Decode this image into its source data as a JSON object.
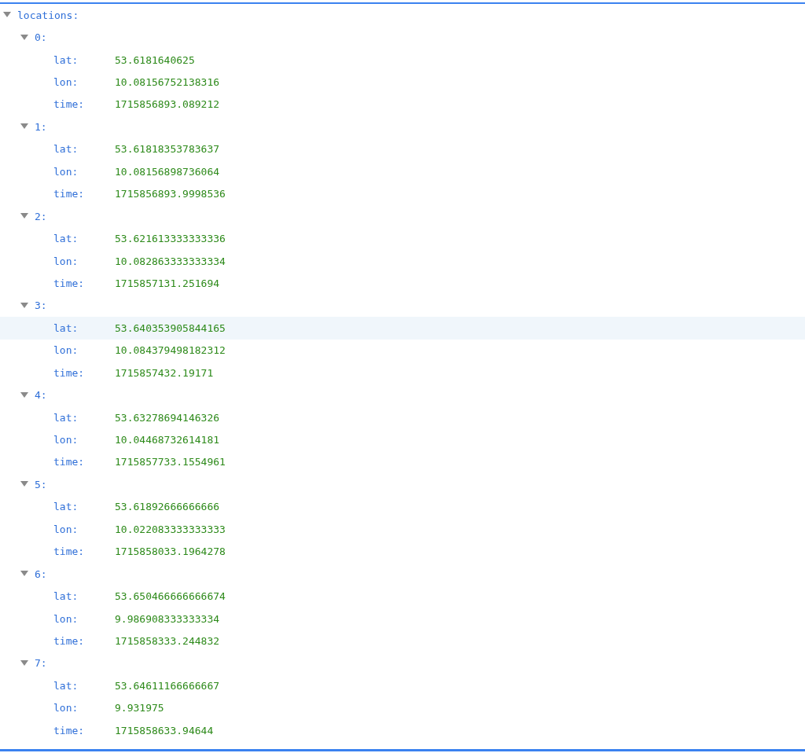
{
  "root": {
    "key": "locations:",
    "expanded": true
  },
  "locations": [
    {
      "key": "0:",
      "expanded": true,
      "fields": [
        {
          "key": "lat:",
          "value": "53.6181640625",
          "highlighted": false
        },
        {
          "key": "lon:",
          "value": "10.08156752138316",
          "highlighted": false
        },
        {
          "key": "time:",
          "value": "1715856893.089212",
          "highlighted": false
        }
      ]
    },
    {
      "key": "1:",
      "expanded": true,
      "fields": [
        {
          "key": "lat:",
          "value": "53.61818353783637",
          "highlighted": false
        },
        {
          "key": "lon:",
          "value": "10.08156898736064",
          "highlighted": false
        },
        {
          "key": "time:",
          "value": "1715856893.9998536",
          "highlighted": false
        }
      ]
    },
    {
      "key": "2:",
      "expanded": true,
      "fields": [
        {
          "key": "lat:",
          "value": "53.621613333333336",
          "highlighted": false
        },
        {
          "key": "lon:",
          "value": "10.082863333333334",
          "highlighted": false
        },
        {
          "key": "time:",
          "value": "1715857131.251694",
          "highlighted": false
        }
      ]
    },
    {
      "key": "3:",
      "expanded": true,
      "fields": [
        {
          "key": "lat:",
          "value": "53.640353905844165",
          "highlighted": true
        },
        {
          "key": "lon:",
          "value": "10.084379498182312",
          "highlighted": false
        },
        {
          "key": "time:",
          "value": "1715857432.19171",
          "highlighted": false
        }
      ]
    },
    {
      "key": "4:",
      "expanded": true,
      "fields": [
        {
          "key": "lat:",
          "value": "53.63278694146326",
          "highlighted": false
        },
        {
          "key": "lon:",
          "value": "10.04468732614181",
          "highlighted": false
        },
        {
          "key": "time:",
          "value": "1715857733.1554961",
          "highlighted": false
        }
      ]
    },
    {
      "key": "5:",
      "expanded": true,
      "fields": [
        {
          "key": "lat:",
          "value": "53.61892666666666",
          "highlighted": false
        },
        {
          "key": "lon:",
          "value": "10.022083333333333",
          "highlighted": false
        },
        {
          "key": "time:",
          "value": "1715858033.1964278",
          "highlighted": false
        }
      ]
    },
    {
      "key": "6:",
      "expanded": true,
      "fields": [
        {
          "key": "lat:",
          "value": "53.650466666666674",
          "highlighted": false
        },
        {
          "key": "lon:",
          "value": "9.986908333333334",
          "highlighted": false
        },
        {
          "key": "time:",
          "value": "1715858333.244832",
          "highlighted": false
        }
      ]
    },
    {
      "key": "7:",
      "expanded": true,
      "fields": [
        {
          "key": "lat:",
          "value": "53.64611166666667",
          "highlighted": false
        },
        {
          "key": "lon:",
          "value": "9.931975",
          "highlighted": false
        },
        {
          "key": "time:",
          "value": "1715858633.94644",
          "highlighted": false
        }
      ]
    }
  ]
}
